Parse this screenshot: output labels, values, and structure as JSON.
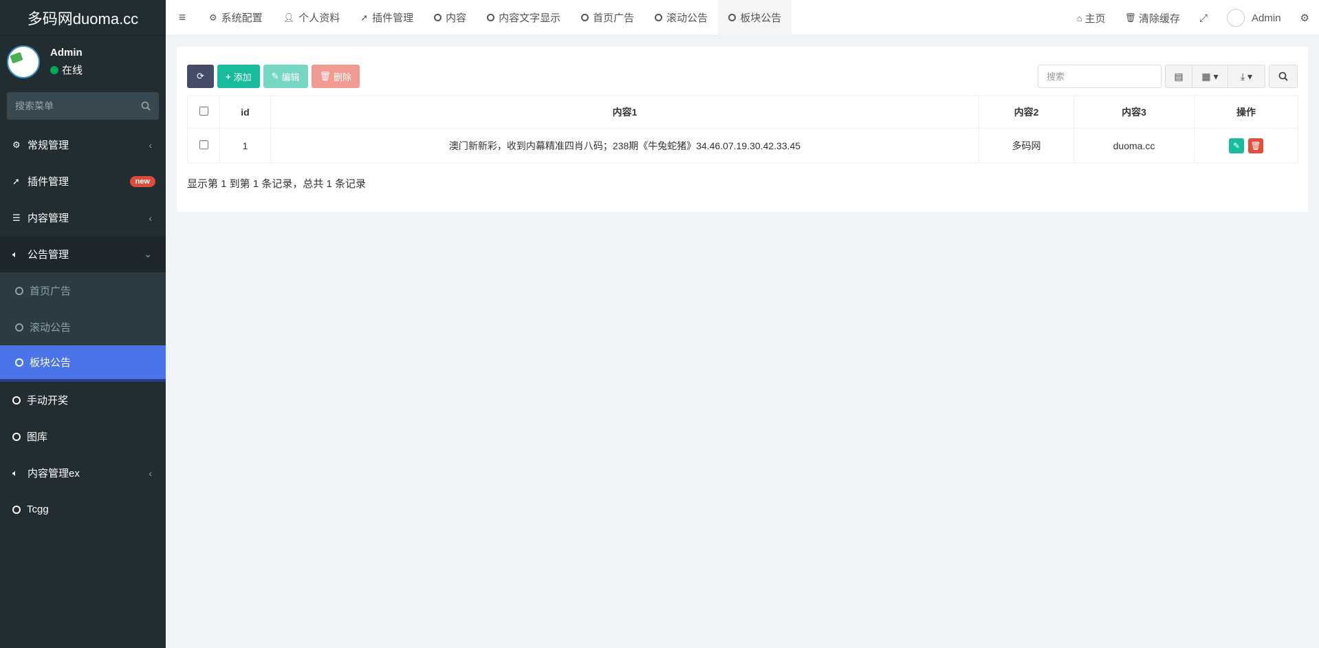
{
  "app": {
    "logo": "多码网duoma.cc"
  },
  "sidebar": {
    "user": {
      "name": "Admin",
      "status": "在线"
    },
    "search_placeholder": "搜索菜单",
    "items": [
      {
        "label": "常规管理",
        "icon": "gears-icon"
      },
      {
        "label": "插件管理",
        "icon": "rocket-icon",
        "badge": "new"
      },
      {
        "label": "内容管理",
        "icon": "list-icon"
      },
      {
        "label": "公告管理",
        "icon": "bullhorn-icon"
      }
    ],
    "sub_items": [
      {
        "label": "首页广告"
      },
      {
        "label": "滚动公告"
      },
      {
        "label": "板块公告"
      }
    ],
    "items2": [
      {
        "label": "手动开奖"
      },
      {
        "label": "图库"
      },
      {
        "label": "内容管理ex"
      },
      {
        "label": "Tcgg"
      }
    ]
  },
  "topbar": {
    "tabs": [
      {
        "label": "系统配置"
      },
      {
        "label": "个人资料"
      },
      {
        "label": "插件管理"
      },
      {
        "label": "内容"
      },
      {
        "label": "内容文字显示"
      },
      {
        "label": "首页广告"
      },
      {
        "label": "滚动公告"
      },
      {
        "label": "板块公告"
      }
    ],
    "home": "主页",
    "clear_cache": "清除缓存",
    "admin": "Admin"
  },
  "toolbar": {
    "add": "添加",
    "edit": "编辑",
    "delete": "删除",
    "search_placeholder": "搜索"
  },
  "table": {
    "columns": [
      "id",
      "内容1",
      "内容2",
      "内容3",
      "操作"
    ],
    "rows": [
      {
        "id": "1",
        "c1": "澳门新新彩，收到内幕精准四肖八码；238期《牛兔蛇猪》34.46.07.19.30.42.33.45",
        "c2": "多码网",
        "c3": "duoma.cc"
      }
    ],
    "info": "显示第 1 到第 1 条记录，总共 1 条记录"
  },
  "colors": {
    "sidebar_bg": "#222d32",
    "active": "#4a74e8",
    "success": "#18bc9c",
    "danger": "#e74c3c"
  }
}
